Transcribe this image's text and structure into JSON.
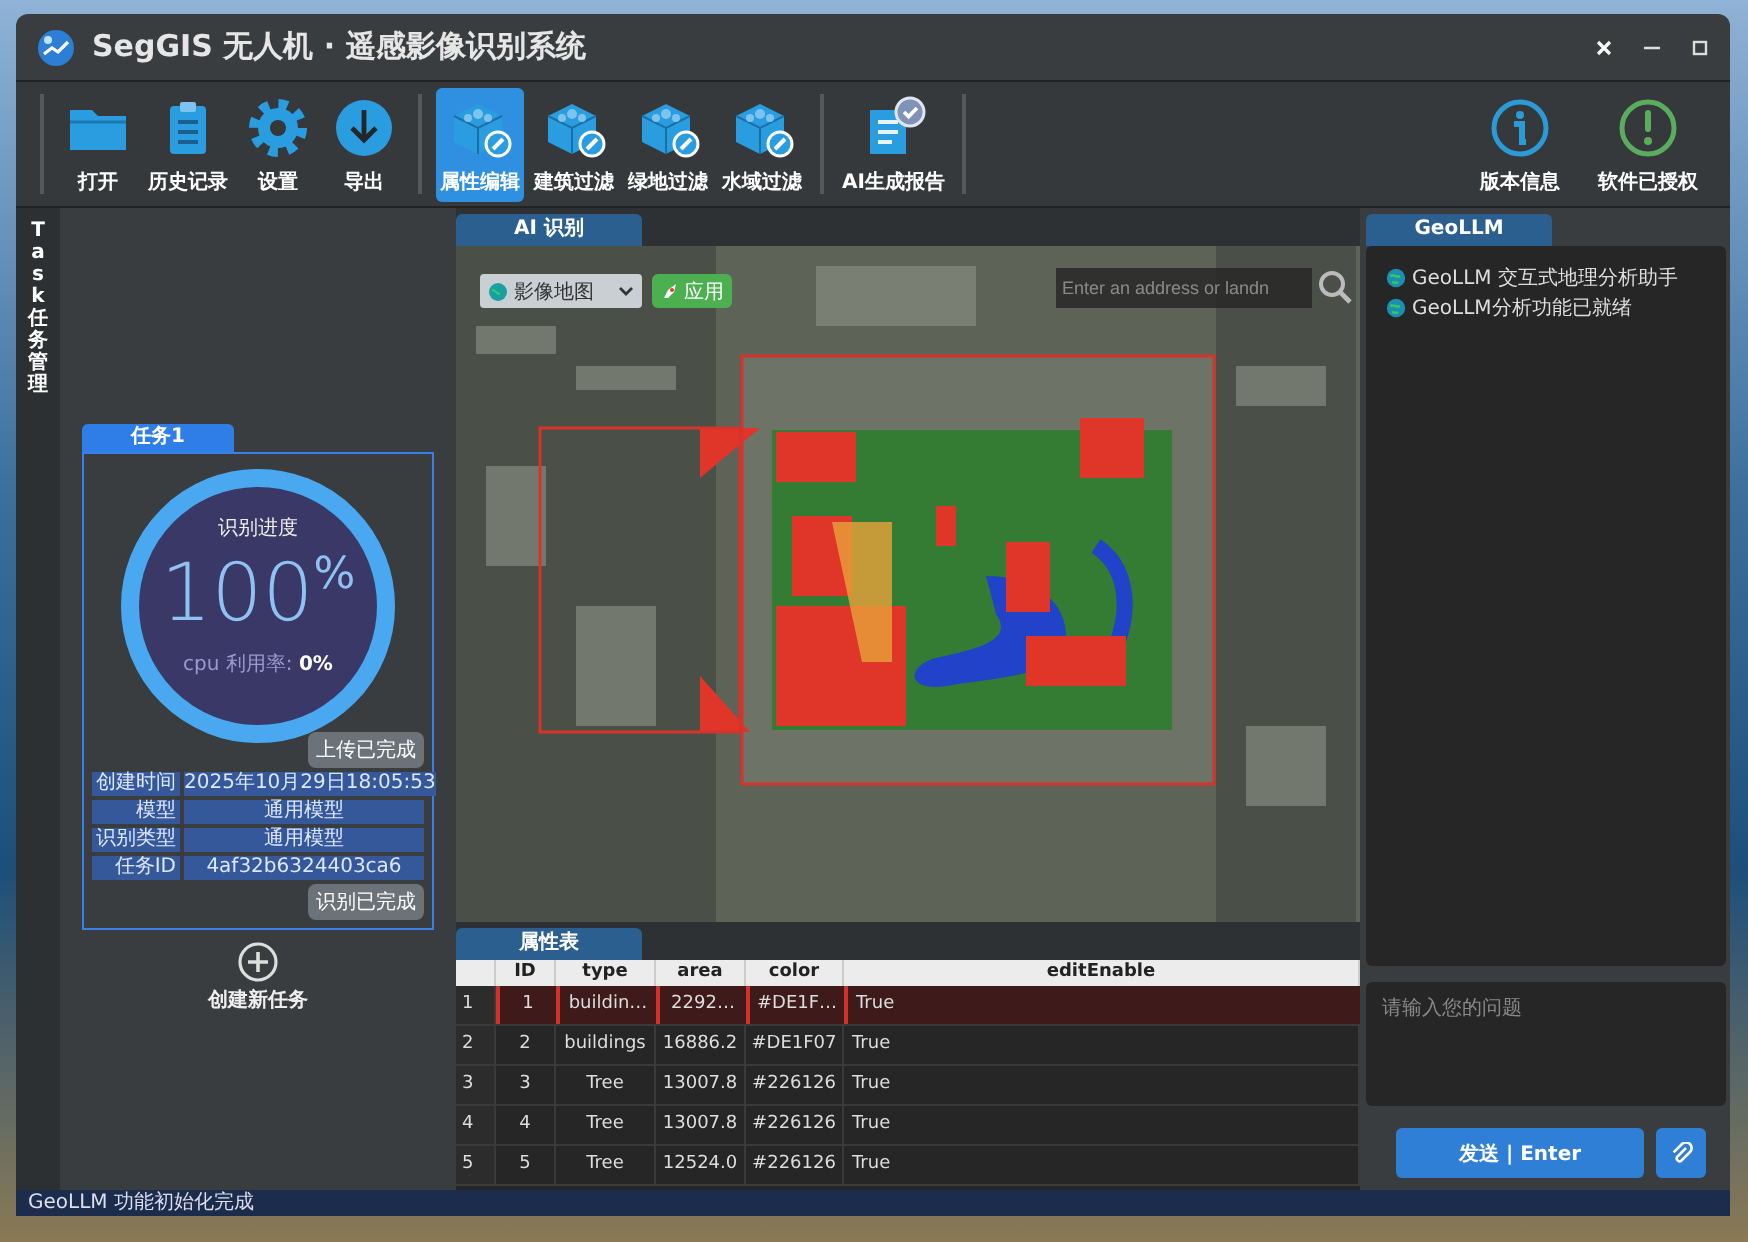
{
  "window": {
    "title": "SegGIS 无人机 · 遥感影像识别系统"
  },
  "toolbar": {
    "groups": [
      [
        {
          "label": "打开",
          "kind": "open",
          "selected": false
        },
        {
          "label": "历史记录",
          "kind": "history",
          "selected": false
        },
        {
          "label": "设置",
          "kind": "settings",
          "selected": false
        },
        {
          "label": "导出",
          "kind": "export",
          "selected": false
        }
      ],
      [
        {
          "label": "属性编辑",
          "kind": "cube",
          "selected": true
        },
        {
          "label": "建筑过滤",
          "kind": "cube",
          "selected": false
        },
        {
          "label": "绿地过滤",
          "kind": "cube",
          "selected": false
        },
        {
          "label": "水域过滤",
          "kind": "cube",
          "selected": false
        }
      ],
      [
        {
          "label": "AI生成报告",
          "kind": "report",
          "selected": false
        }
      ]
    ],
    "right": [
      {
        "label": "版本信息",
        "kind": "info"
      },
      {
        "label": "软件已授权",
        "kind": "license"
      }
    ]
  },
  "task_panel": {
    "tab": "Task 任务管理",
    "task": {
      "title": "任务1",
      "progress_label": "识别进度",
      "level": 1,
      "value": "100",
      "unit": "%",
      "cpu": "cpu 利用率: **0%**",
      "upload_status": "上传已完成",
      "fields": [
        {
          "label": "创建时间",
          "value": "2025年10月29日18:05:53"
        },
        {
          "label": "模型",
          "value": "通用模型"
        },
        {
          "label": "识别类型",
          "value": "通用模型"
        },
        {
          "label": "任务ID",
          "value": "4af32b6324403ca6"
        }
      ],
      "recognition_status": "识别已完成"
    },
    "new_task": "创建新任务"
  },
  "map_panel": {
    "tab": "AI 识别",
    "layer_select": "影像地图",
    "apply": "应用",
    "search": {
      "placeholder": "Enter an address or landn"
    }
  },
  "attribute_table": {
    "tab": "属性表",
    "columns": [
      "ID",
      "type",
      "area",
      "color",
      "editEnable"
    ],
    "rows": [
      {
        "row": "1",
        "selected": true,
        "cells": [
          "1",
          "buildin…",
          "2292…",
          "#DE1F…",
          "True"
        ]
      },
      {
        "row": "2",
        "selected": false,
        "cells": [
          "2",
          "buildings",
          "16886.2",
          "#DE1F07",
          "True"
        ]
      },
      {
        "row": "3",
        "selected": false,
        "cells": [
          "3",
          "Tree",
          "13007.8",
          "#226126",
          "True"
        ]
      },
      {
        "row": "4",
        "selected": false,
        "cells": [
          "4",
          "Tree",
          "13007.8",
          "#226126",
          "True"
        ]
      },
      {
        "row": "5",
        "selected": false,
        "cells": [
          "5",
          "Tree",
          "12524.0",
          "#226126",
          "True"
        ]
      }
    ]
  },
  "chat": {
    "tab": "GeoLLM",
    "messages": [
      "GeoLLM 交互式地理分析助手",
      "GeoLLM分析功能已就绪"
    ],
    "input": {
      "placeholder": "请输入您的问题"
    },
    "send": "发送 | Enter"
  },
  "status_bar": "GeoLLM 功能初始化完成"
}
